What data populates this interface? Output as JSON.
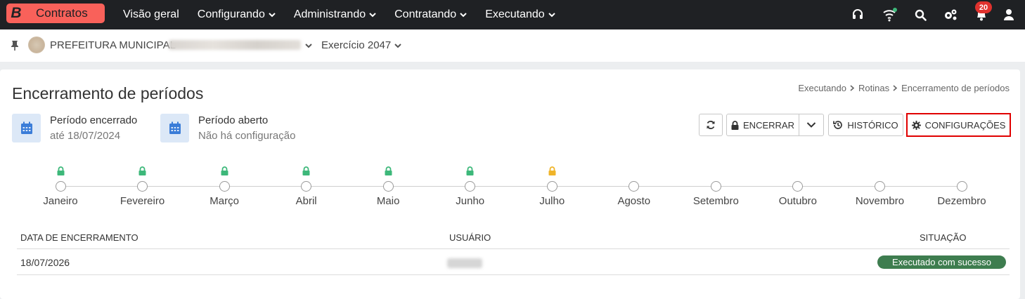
{
  "brand": {
    "letter": "B",
    "name": "Contratos",
    "color": "#f9615a"
  },
  "nav": {
    "items": [
      {
        "label": "Visão geral",
        "has_dropdown": false
      },
      {
        "label": "Configurando",
        "has_dropdown": true
      },
      {
        "label": "Administrando",
        "has_dropdown": true
      },
      {
        "label": "Contratando",
        "has_dropdown": true
      },
      {
        "label": "Executando",
        "has_dropdown": true
      }
    ],
    "icons": [
      "headset-icon",
      "wifi-icon",
      "search-icon",
      "gears-icon",
      "bell-icon",
      "user-icon"
    ],
    "notification_count": "20"
  },
  "context": {
    "organization": "PREFEITURA MUNICIPAL",
    "exercise": "Exercício 2047"
  },
  "page": {
    "title": "Encerramento de períodos",
    "breadcrumb": [
      "Executando",
      "Rotinas",
      "Encerramento de períodos"
    ]
  },
  "summary": {
    "closed": {
      "title": "Período encerrado",
      "subtitle": "até 18/07/2024"
    },
    "open": {
      "title": "Período aberto",
      "subtitle": "Não há configuração"
    }
  },
  "toolbar": {
    "refresh_icon": "refresh-icon",
    "close_label": "ENCERRAR",
    "history_label": "HISTÓRICO",
    "config_label": "CONFIGURAÇÕES"
  },
  "timeline": {
    "months": [
      {
        "label": "Janeiro",
        "lock": "closed"
      },
      {
        "label": "Fevereiro",
        "lock": "closed"
      },
      {
        "label": "Março",
        "lock": "closed"
      },
      {
        "label": "Abril",
        "lock": "closed"
      },
      {
        "label": "Maio",
        "lock": "closed"
      },
      {
        "label": "Junho",
        "lock": "closed"
      },
      {
        "label": "Julho",
        "lock": "warning"
      },
      {
        "label": "Agosto",
        "lock": ""
      },
      {
        "label": "Setembro",
        "lock": ""
      },
      {
        "label": "Outubro",
        "lock": ""
      },
      {
        "label": "Novembro",
        "lock": ""
      },
      {
        "label": "Dezembro",
        "lock": ""
      }
    ],
    "lock_colors": {
      "closed": "#3db87a",
      "warning": "#f0b429"
    }
  },
  "table": {
    "headers": {
      "date": "DATA DE ENCERRAMENTO",
      "user": "USUÁRIO",
      "status": "SITUAÇÃO"
    },
    "rows": [
      {
        "date": "18/07/2026",
        "user": "",
        "status": "Executado com sucesso"
      }
    ],
    "status_color": "#3e7d4f"
  }
}
